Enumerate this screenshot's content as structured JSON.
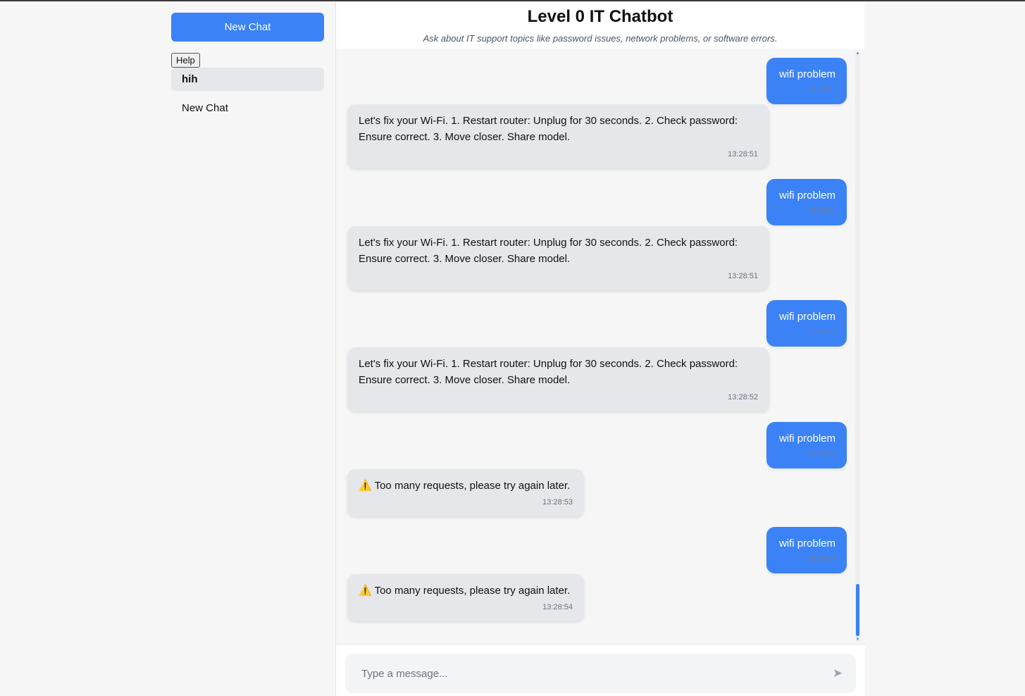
{
  "sidebar": {
    "new_chat_label": "New Chat",
    "help_label": "Help",
    "chats": [
      {
        "label": "hih"
      },
      {
        "label": "New Chat"
      }
    ]
  },
  "header": {
    "title": "Level 0 IT Chatbot",
    "subtitle": "Ask about IT support topics like password issues, network problems, or software errors."
  },
  "messages": [
    {
      "role": "user",
      "text": "wifi problem",
      "time": "13:28:51"
    },
    {
      "role": "bot",
      "text": "Let's fix your Wi-Fi. 1. Restart router: Unplug for 30 seconds. 2. Check password: Ensure correct. 3. Move closer. Share model.",
      "time": "13:28:51"
    },
    {
      "role": "user",
      "text": "wifi problem",
      "time": "13:28:51"
    },
    {
      "role": "bot",
      "text": "Let's fix your Wi-Fi. 1. Restart router: Unplug for 30 seconds. 2. Check password: Ensure correct. 3. Move closer. Share model.",
      "time": "13:28:51"
    },
    {
      "role": "user",
      "text": "wifi problem",
      "time": "13:28:52"
    },
    {
      "role": "bot",
      "text": "Let's fix your Wi-Fi. 1. Restart router: Unplug for 30 seconds. 2. Check password: Ensure correct. 3. Move closer. Share model.",
      "time": "13:28:52"
    },
    {
      "role": "user",
      "text": "wifi problem",
      "time": "13:28:53"
    },
    {
      "role": "bot",
      "icon": "⚠️",
      "text": "Too many requests, please try again later.",
      "time": "13:28:53"
    },
    {
      "role": "user",
      "text": "wifi problem",
      "time": "13:28:54"
    },
    {
      "role": "bot",
      "icon": "⚠️",
      "text": "Too many requests, please try again later.",
      "time": "13:28:54"
    }
  ],
  "composer": {
    "placeholder": "Type a message...",
    "send_icon": "➤"
  },
  "colors": {
    "accent": "#3b82f6",
    "bot_bubble": "#e6e7ea"
  }
}
